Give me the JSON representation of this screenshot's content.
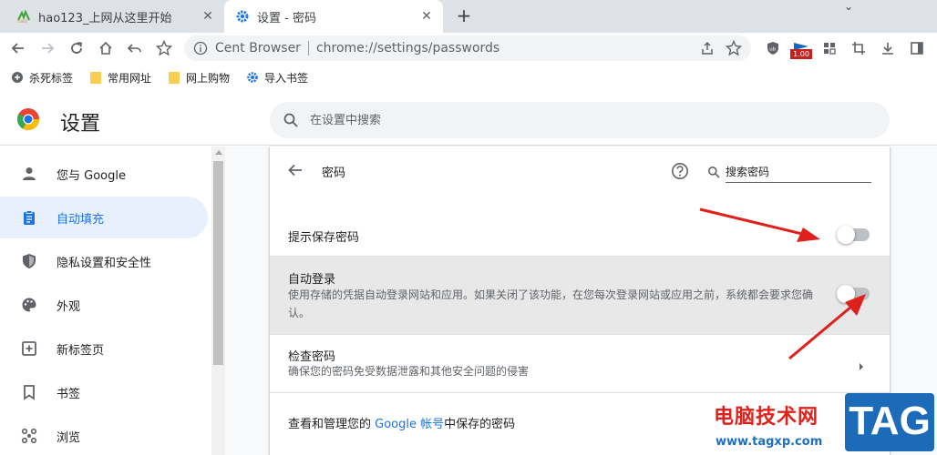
{
  "tabs": [
    {
      "title": "hao123_上网从这里开始",
      "active": false
    },
    {
      "title": "设置 - 密码",
      "active": true
    }
  ],
  "toolbar": {
    "site_label": "Cent Browser",
    "url": "chrome://settings/passwords",
    "extension_badge": "1.00"
  },
  "bookmarks": [
    {
      "label": "杀死标签",
      "icon": "kill-tab-icon"
    },
    {
      "label": "常用网址",
      "icon": "folder-icon"
    },
    {
      "label": "网上购物",
      "icon": "folder-icon"
    },
    {
      "label": "导入书签",
      "icon": "gear-icon"
    }
  ],
  "header": {
    "title": "设置",
    "search_placeholder": "在设置中搜索"
  },
  "sidebar": {
    "items": [
      {
        "label": "您与 Google",
        "icon": "person-icon",
        "active": false
      },
      {
        "label": "自动填充",
        "icon": "clipboard-icon",
        "active": true
      },
      {
        "label": "隐私设置和安全性",
        "icon": "shield-icon",
        "active": false
      },
      {
        "label": "外观",
        "icon": "palette-icon",
        "active": false
      },
      {
        "label": "新标签页",
        "icon": "new-tab-icon",
        "active": false
      },
      {
        "label": "书签",
        "icon": "bookmark-icon",
        "active": false
      },
      {
        "label": "浏览",
        "icon": "browse-icon",
        "active": false
      }
    ]
  },
  "passwords": {
    "title": "密码",
    "search_placeholder": "搜索密码",
    "offer_to_save": {
      "label": "提示保存密码",
      "enabled": false
    },
    "auto_signin": {
      "label": "自动登录",
      "description": "使用存储的凭据自动登录网站和应用。如果关闭了该功能，在您每次登录网站或应用之前，系统都会要求您确认。",
      "enabled": false
    },
    "check_passwords": {
      "label": "检查密码",
      "description": "确保您的密码免受数据泄露和其他安全问题的侵害"
    },
    "google_account": {
      "prefix": "查看和管理您的",
      "link": "Google 帐号",
      "suffix": "中保存的密码"
    }
  },
  "watermark": {
    "text": "电脑技术网",
    "url": "www.tagxp.com",
    "logo": "TAG"
  },
  "colors": {
    "accent": "#1a73e8",
    "arrow": "#e0201a",
    "active_bg": "#e8f0fe"
  }
}
